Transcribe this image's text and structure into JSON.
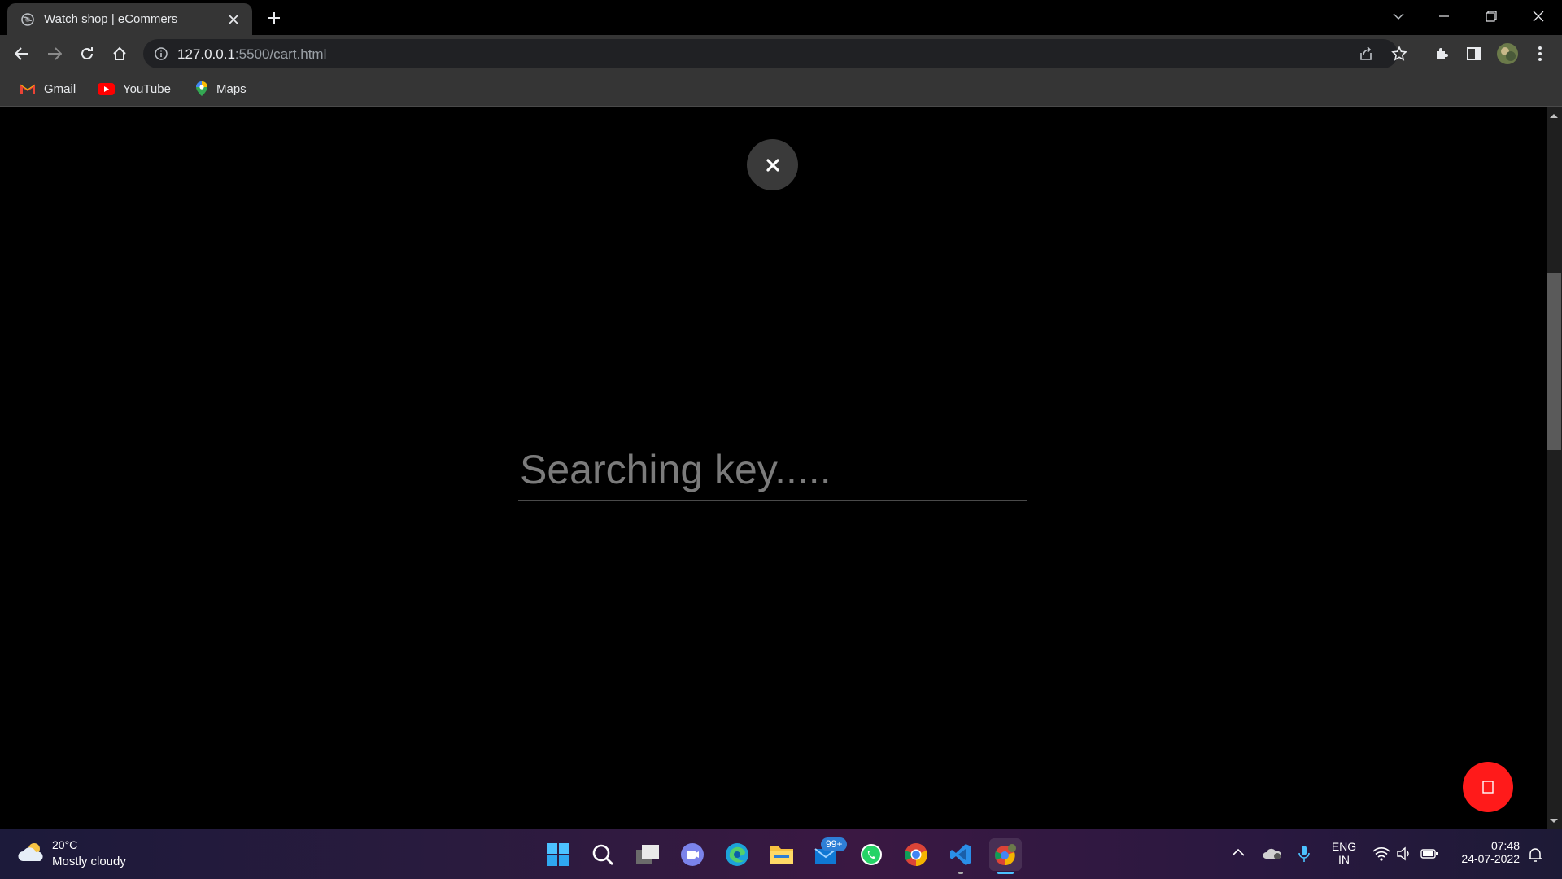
{
  "browser": {
    "tab_title": "Watch shop | eCommers",
    "url_host": "127.0.0.1",
    "url_path": ":5500/cart.html",
    "bookmarks": [
      {
        "label": "Gmail",
        "icon": "gmail-icon"
      },
      {
        "label": "YouTube",
        "icon": "youtube-icon"
      },
      {
        "label": "Maps",
        "icon": "maps-icon"
      }
    ]
  },
  "page": {
    "search_placeholder": "Searching key.....",
    "close_icon": "close-icon",
    "fab_icon": "cart-icon",
    "fab_color": "#ff1a1a"
  },
  "taskbar": {
    "weather_temp": "20°C",
    "weather_desc": "Mostly cloudy",
    "badge_count": "99+",
    "lang_line1": "ENG",
    "lang_line2": "IN",
    "time": "07:48",
    "date": "24-07-2022"
  }
}
